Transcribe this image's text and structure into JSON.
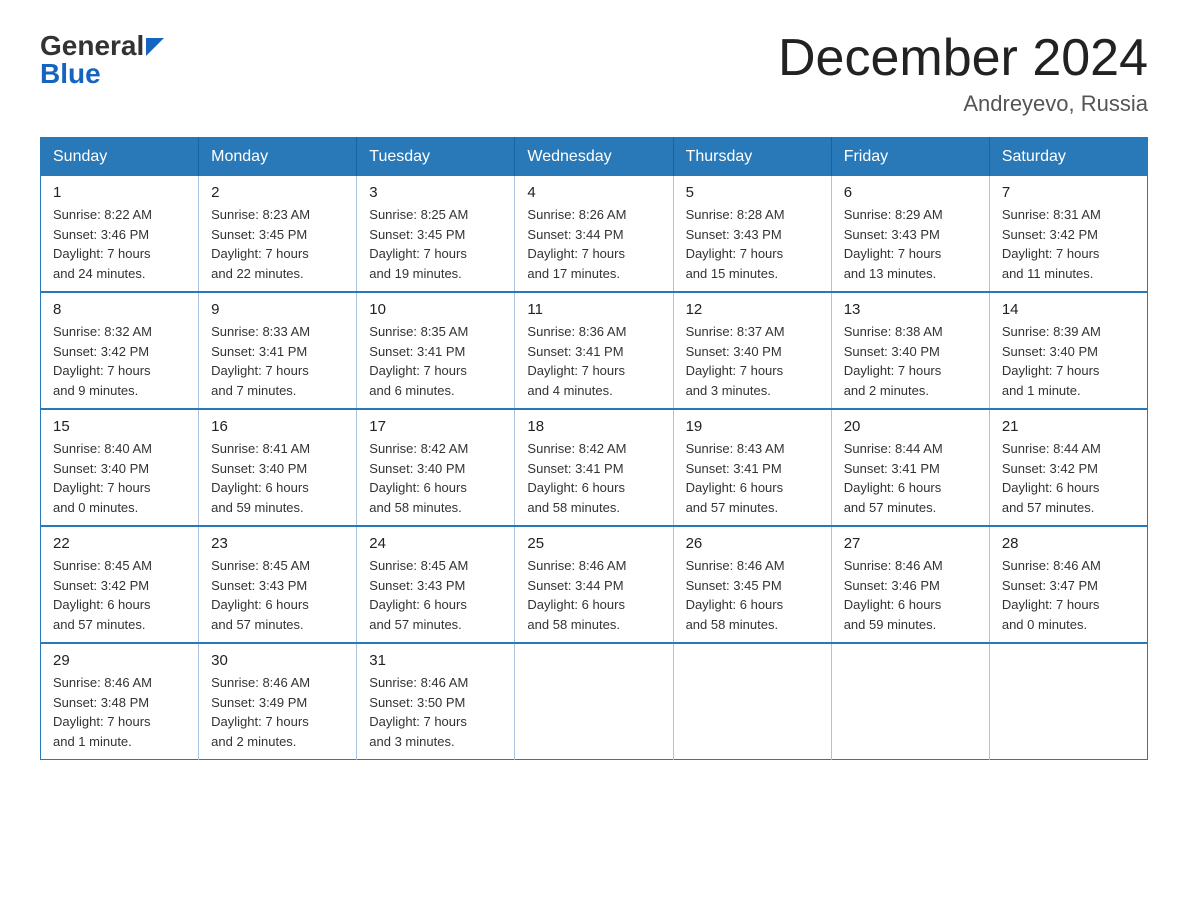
{
  "logo": {
    "text_general": "General",
    "text_blue": "Blue",
    "triangle": "▶"
  },
  "title": "December 2024",
  "location": "Andreyevo, Russia",
  "headers": [
    "Sunday",
    "Monday",
    "Tuesday",
    "Wednesday",
    "Thursday",
    "Friday",
    "Saturday"
  ],
  "weeks": [
    [
      {
        "day": "1",
        "info": "Sunrise: 8:22 AM\nSunset: 3:46 PM\nDaylight: 7 hours\nand 24 minutes."
      },
      {
        "day": "2",
        "info": "Sunrise: 8:23 AM\nSunset: 3:45 PM\nDaylight: 7 hours\nand 22 minutes."
      },
      {
        "day": "3",
        "info": "Sunrise: 8:25 AM\nSunset: 3:45 PM\nDaylight: 7 hours\nand 19 minutes."
      },
      {
        "day": "4",
        "info": "Sunrise: 8:26 AM\nSunset: 3:44 PM\nDaylight: 7 hours\nand 17 minutes."
      },
      {
        "day": "5",
        "info": "Sunrise: 8:28 AM\nSunset: 3:43 PM\nDaylight: 7 hours\nand 15 minutes."
      },
      {
        "day": "6",
        "info": "Sunrise: 8:29 AM\nSunset: 3:43 PM\nDaylight: 7 hours\nand 13 minutes."
      },
      {
        "day": "7",
        "info": "Sunrise: 8:31 AM\nSunset: 3:42 PM\nDaylight: 7 hours\nand 11 minutes."
      }
    ],
    [
      {
        "day": "8",
        "info": "Sunrise: 8:32 AM\nSunset: 3:42 PM\nDaylight: 7 hours\nand 9 minutes."
      },
      {
        "day": "9",
        "info": "Sunrise: 8:33 AM\nSunset: 3:41 PM\nDaylight: 7 hours\nand 7 minutes."
      },
      {
        "day": "10",
        "info": "Sunrise: 8:35 AM\nSunset: 3:41 PM\nDaylight: 7 hours\nand 6 minutes."
      },
      {
        "day": "11",
        "info": "Sunrise: 8:36 AM\nSunset: 3:41 PM\nDaylight: 7 hours\nand 4 minutes."
      },
      {
        "day": "12",
        "info": "Sunrise: 8:37 AM\nSunset: 3:40 PM\nDaylight: 7 hours\nand 3 minutes."
      },
      {
        "day": "13",
        "info": "Sunrise: 8:38 AM\nSunset: 3:40 PM\nDaylight: 7 hours\nand 2 minutes."
      },
      {
        "day": "14",
        "info": "Sunrise: 8:39 AM\nSunset: 3:40 PM\nDaylight: 7 hours\nand 1 minute."
      }
    ],
    [
      {
        "day": "15",
        "info": "Sunrise: 8:40 AM\nSunset: 3:40 PM\nDaylight: 7 hours\nand 0 minutes."
      },
      {
        "day": "16",
        "info": "Sunrise: 8:41 AM\nSunset: 3:40 PM\nDaylight: 6 hours\nand 59 minutes."
      },
      {
        "day": "17",
        "info": "Sunrise: 8:42 AM\nSunset: 3:40 PM\nDaylight: 6 hours\nand 58 minutes."
      },
      {
        "day": "18",
        "info": "Sunrise: 8:42 AM\nSunset: 3:41 PM\nDaylight: 6 hours\nand 58 minutes."
      },
      {
        "day": "19",
        "info": "Sunrise: 8:43 AM\nSunset: 3:41 PM\nDaylight: 6 hours\nand 57 minutes."
      },
      {
        "day": "20",
        "info": "Sunrise: 8:44 AM\nSunset: 3:41 PM\nDaylight: 6 hours\nand 57 minutes."
      },
      {
        "day": "21",
        "info": "Sunrise: 8:44 AM\nSunset: 3:42 PM\nDaylight: 6 hours\nand 57 minutes."
      }
    ],
    [
      {
        "day": "22",
        "info": "Sunrise: 8:45 AM\nSunset: 3:42 PM\nDaylight: 6 hours\nand 57 minutes."
      },
      {
        "day": "23",
        "info": "Sunrise: 8:45 AM\nSunset: 3:43 PM\nDaylight: 6 hours\nand 57 minutes."
      },
      {
        "day": "24",
        "info": "Sunrise: 8:45 AM\nSunset: 3:43 PM\nDaylight: 6 hours\nand 57 minutes."
      },
      {
        "day": "25",
        "info": "Sunrise: 8:46 AM\nSunset: 3:44 PM\nDaylight: 6 hours\nand 58 minutes."
      },
      {
        "day": "26",
        "info": "Sunrise: 8:46 AM\nSunset: 3:45 PM\nDaylight: 6 hours\nand 58 minutes."
      },
      {
        "day": "27",
        "info": "Sunrise: 8:46 AM\nSunset: 3:46 PM\nDaylight: 6 hours\nand 59 minutes."
      },
      {
        "day": "28",
        "info": "Sunrise: 8:46 AM\nSunset: 3:47 PM\nDaylight: 7 hours\nand 0 minutes."
      }
    ],
    [
      {
        "day": "29",
        "info": "Sunrise: 8:46 AM\nSunset: 3:48 PM\nDaylight: 7 hours\nand 1 minute."
      },
      {
        "day": "30",
        "info": "Sunrise: 8:46 AM\nSunset: 3:49 PM\nDaylight: 7 hours\nand 2 minutes."
      },
      {
        "day": "31",
        "info": "Sunrise: 8:46 AM\nSunset: 3:50 PM\nDaylight: 7 hours\nand 3 minutes."
      },
      {
        "day": "",
        "info": ""
      },
      {
        "day": "",
        "info": ""
      },
      {
        "day": "",
        "info": ""
      },
      {
        "day": "",
        "info": ""
      }
    ]
  ]
}
